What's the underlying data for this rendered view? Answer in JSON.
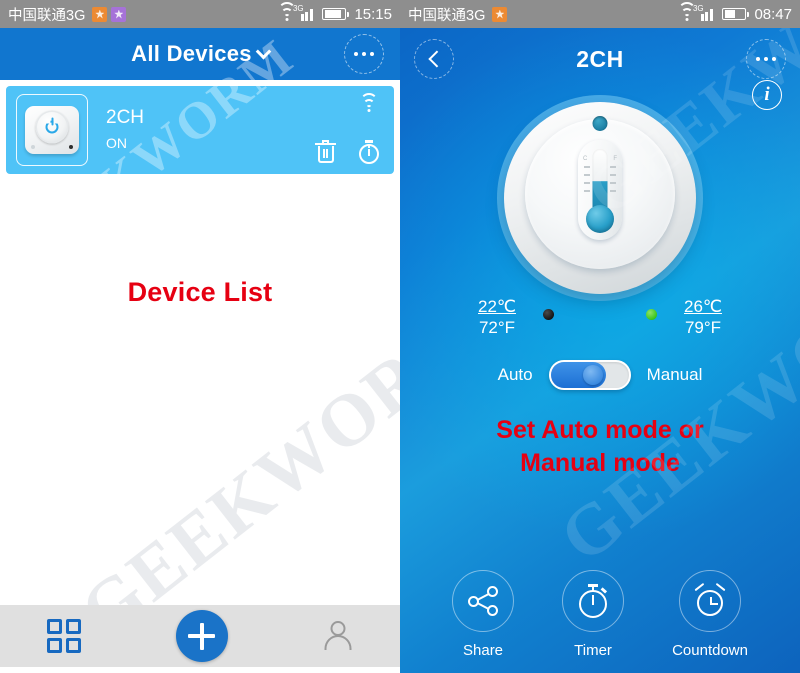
{
  "left_phone": {
    "status_bar": {
      "carrier": "中国联通3G",
      "app_icons": [
        "notification-icon-orange",
        "notification-icon-purple"
      ],
      "network_type": "3G",
      "time": "15:15",
      "icons": [
        "wifi-icon",
        "signal-icon",
        "battery-icon"
      ]
    },
    "header": {
      "title": "All Devices",
      "dropdown_icon": "chevron-down-icon",
      "overflow_icon": "more-options-icon"
    },
    "device": {
      "name": "2CH",
      "state": "ON",
      "thumb_icon": "power-switch-icon",
      "wifi_icon": "wifi-icon",
      "delete_icon": "trash-icon",
      "timer_icon": "stopwatch-icon"
    },
    "annotation": "Device List",
    "nav": {
      "devices_icon": "grid-icon",
      "add_icon": "plus-icon",
      "profile_icon": "person-icon"
    },
    "watermark": "GEEKWORM"
  },
  "right_phone": {
    "status_bar": {
      "carrier": "中国联通3G",
      "app_icons": [
        "notification-icon-orange"
      ],
      "network_type": "3G",
      "time": "08:47",
      "icons": [
        "wifi-icon",
        "signal-icon",
        "battery-icon"
      ]
    },
    "header": {
      "title": "2CH",
      "back_icon": "back-chevron-icon",
      "overflow_icon": "more-options-icon",
      "info_icon": "info-icon",
      "info_label": "i"
    },
    "dial": {
      "indicator_icon": "status-dot-icon",
      "thermometer_icon": "thermometer-icon",
      "unit_c": "C",
      "unit_f": "F"
    },
    "temperatures": {
      "low_celsius": "22℃",
      "low_fahrenheit": "72°F",
      "low_dot": "black-indicator-dot",
      "high_celsius": "26℃",
      "high_fahrenheit": "79°F",
      "high_dot": "green-indicator-dot"
    },
    "mode": {
      "auto_label": "Auto",
      "manual_label": "Manual",
      "selected": "Auto",
      "toggle_icon": "mode-toggle"
    },
    "annotation_line1": "Set Auto mode or",
    "annotation_line2": "Manual mode",
    "actions": [
      {
        "label": "Share",
        "icon": "share-icon"
      },
      {
        "label": "Timer",
        "icon": "stopwatch-icon"
      },
      {
        "label": "Countdown",
        "icon": "alarm-clock-icon"
      }
    ],
    "watermark": "GEEKWORM"
  },
  "colors": {
    "header_blue": "#1176cf",
    "card_blue": "#4fc3f7",
    "accent_blue": "#1a73c8",
    "annotation_red": "#e60012",
    "statusbar_gray": "#8e8e8e",
    "nav_gray": "#e0e0e0"
  }
}
